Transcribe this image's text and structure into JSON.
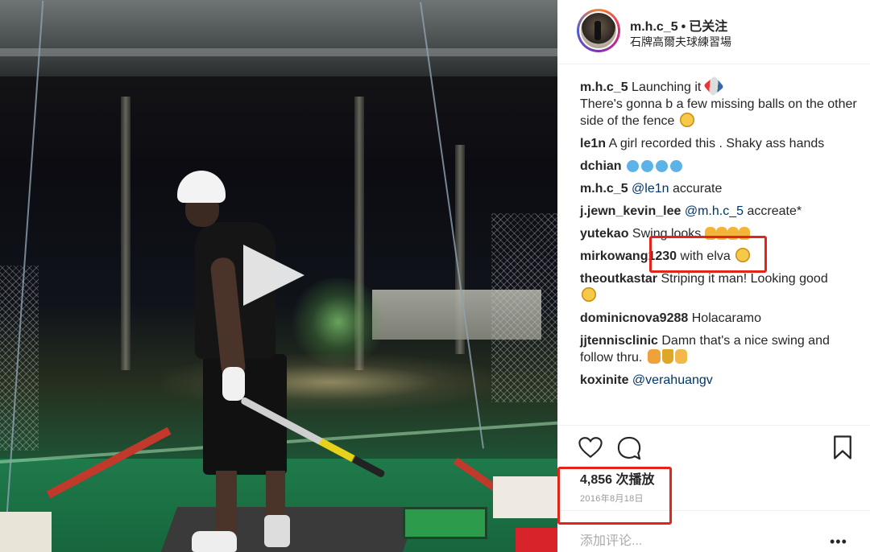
{
  "header": {
    "username": "m.h.c_5",
    "separator": "•",
    "follow_status": "已关注",
    "location": "石牌高爾夫球練習場"
  },
  "comments": [
    {
      "user": "m.h.c_5",
      "text": "Launching it",
      "text2": "There's gonna b a few missing balls on the other side of the fence",
      "emoji": "rocket-icon"
    },
    {
      "user": "le1n",
      "text": "A girl recorded this . Shaky ass hands"
    },
    {
      "user": "dchian",
      "text": ""
    },
    {
      "user": "m.h.c_5",
      "mention": "@le1n",
      "text": "accurate"
    },
    {
      "user": "j.jewn_kevin_lee",
      "mention": "@m.h.c_5",
      "text": "accreate*"
    },
    {
      "user": "yutekao",
      "text": "Swing looks"
    },
    {
      "user": "mirkowang1230",
      "text": "with elva"
    },
    {
      "user": "theoutkastar",
      "text": "Striping it man! Looking good"
    },
    {
      "user": "dominicnova9288",
      "text": "Holacaramo"
    },
    {
      "user": "jjtennisclinic",
      "text": "Damn that's a nice swing and follow thru."
    },
    {
      "user": "koxinite",
      "mention": "@verahuangv",
      "text": ""
    }
  ],
  "stats": {
    "views": "4,856 次播放",
    "date": "2016年8月18日"
  },
  "composer": {
    "placeholder": "添加评论...",
    "more": "•••"
  },
  "colors": {
    "annotation": "#e3241b",
    "mention": "#003569"
  }
}
